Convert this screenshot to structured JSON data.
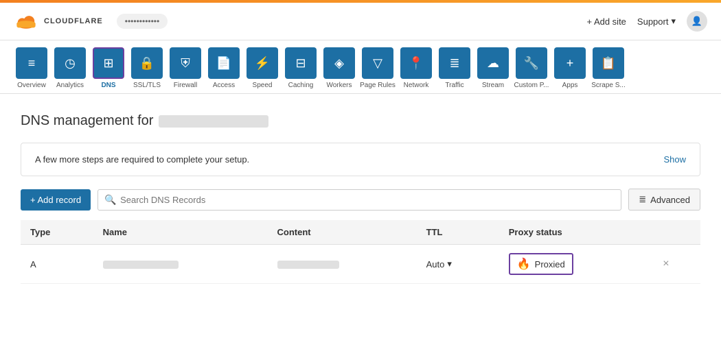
{
  "topbar": {},
  "header": {
    "logo_text": "CLOUDFLARE",
    "domain": "••••••••••••",
    "add_site": "+ Add site",
    "support": "Support",
    "user_icon": "▾"
  },
  "nav": {
    "items": [
      {
        "id": "overview",
        "label": "Overview",
        "icon": "≡",
        "active": false
      },
      {
        "id": "analytics",
        "label": "Analytics",
        "icon": "◷",
        "active": false
      },
      {
        "id": "dns",
        "label": "DNS",
        "icon": "⊞",
        "active": true
      },
      {
        "id": "ssl-tls",
        "label": "SSL/TLS",
        "icon": "🔒",
        "active": false
      },
      {
        "id": "firewall",
        "label": "Firewall",
        "icon": "⛨",
        "active": false
      },
      {
        "id": "access",
        "label": "Access",
        "icon": "📄",
        "active": false
      },
      {
        "id": "speed",
        "label": "Speed",
        "icon": "⚡",
        "active": false
      },
      {
        "id": "caching",
        "label": "Caching",
        "icon": "⊟",
        "active": false
      },
      {
        "id": "workers",
        "label": "Workers",
        "icon": "◈",
        "active": false
      },
      {
        "id": "page-rules",
        "label": "Page Rules",
        "icon": "▽",
        "active": false
      },
      {
        "id": "network",
        "label": "Network",
        "icon": "📍",
        "active": false
      },
      {
        "id": "traffic",
        "label": "Traffic",
        "icon": "≣",
        "active": false
      },
      {
        "id": "stream",
        "label": "Stream",
        "icon": "☁",
        "active": false
      },
      {
        "id": "custom-pages",
        "label": "Custom P...",
        "icon": "🔧",
        "active": false
      },
      {
        "id": "apps",
        "label": "Apps",
        "icon": "+",
        "active": false
      },
      {
        "id": "scrape-shield",
        "label": "Scrape S...",
        "icon": "📋",
        "active": false
      }
    ]
  },
  "page": {
    "title": "DNS management for",
    "domain_masked": true,
    "setup_banner": {
      "text": "A few more steps are required to complete your setup.",
      "link": "Show"
    },
    "toolbar": {
      "add_record": "+ Add record",
      "search_placeholder": "Search DNS Records",
      "advanced": "Advanced"
    },
    "table": {
      "headers": [
        "Type",
        "Name",
        "Content",
        "TTL",
        "Proxy status",
        ""
      ],
      "rows": [
        {
          "type": "A",
          "name": "••••••••••••",
          "content": "••• ••• ••• •",
          "ttl": "Auto",
          "proxied": true
        }
      ]
    }
  }
}
